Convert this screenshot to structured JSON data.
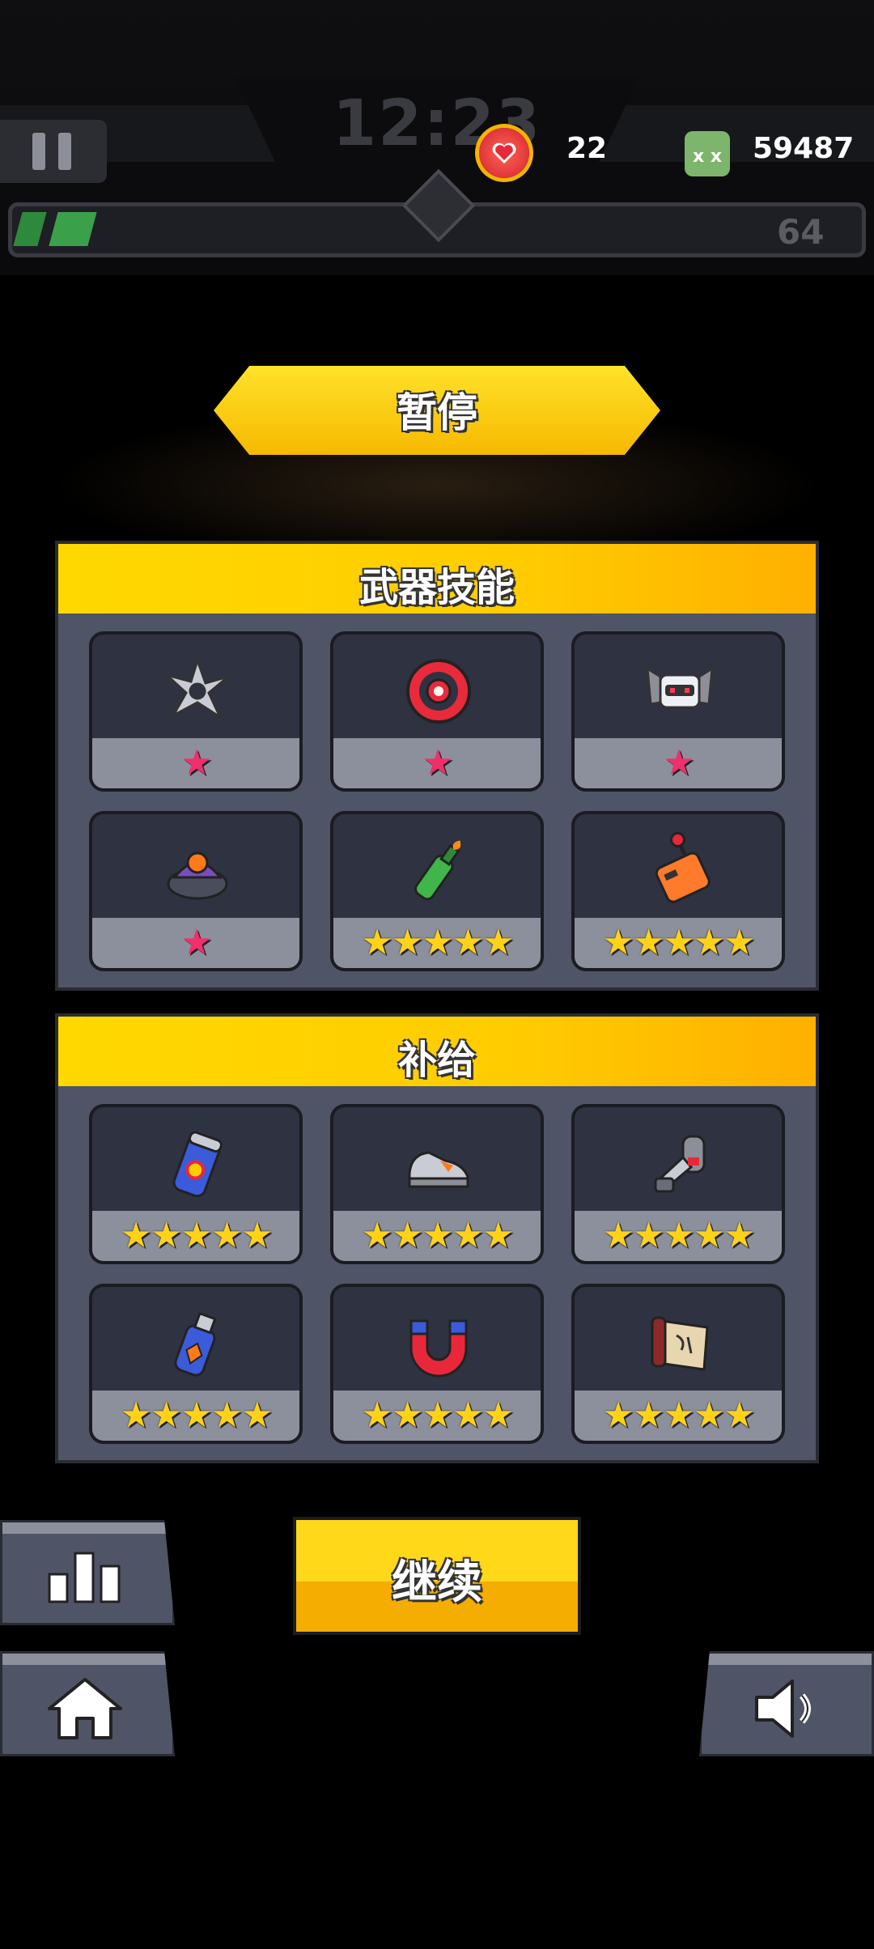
{
  "hud": {
    "timer": "12:23",
    "hearts": "22",
    "kills": "59487",
    "level": "64"
  },
  "pause": {
    "title": "暂停"
  },
  "weapons": {
    "title": "武器技能",
    "items": [
      {
        "icon": "shuriken-icon",
        "stars": 1
      },
      {
        "icon": "red-disc-icon",
        "stars": 1
      },
      {
        "icon": "robot-drone-icon",
        "stars": 1
      },
      {
        "icon": "purple-turret-icon",
        "stars": 1
      },
      {
        "icon": "molotov-bottle-icon",
        "stars": 5
      },
      {
        "icon": "remote-controller-icon",
        "stars": 5
      }
    ]
  },
  "supplies": {
    "title": "补给",
    "items": [
      {
        "icon": "energy-drink-icon",
        "stars": 5
      },
      {
        "icon": "sneaker-icon",
        "stars": 5
      },
      {
        "icon": "armored-arm-icon",
        "stars": 5
      },
      {
        "icon": "potion-bottle-icon",
        "stars": 5
      },
      {
        "icon": "magnet-icon",
        "stars": 5
      },
      {
        "icon": "scroll-icon",
        "stars": 5
      }
    ]
  },
  "buttons": {
    "continue": "继续"
  },
  "colors": {
    "accent": "#ffd800",
    "panel": "#4f5466",
    "tile": "#2f3240",
    "star": "#ffd21a",
    "star_red": "#f0306a"
  }
}
